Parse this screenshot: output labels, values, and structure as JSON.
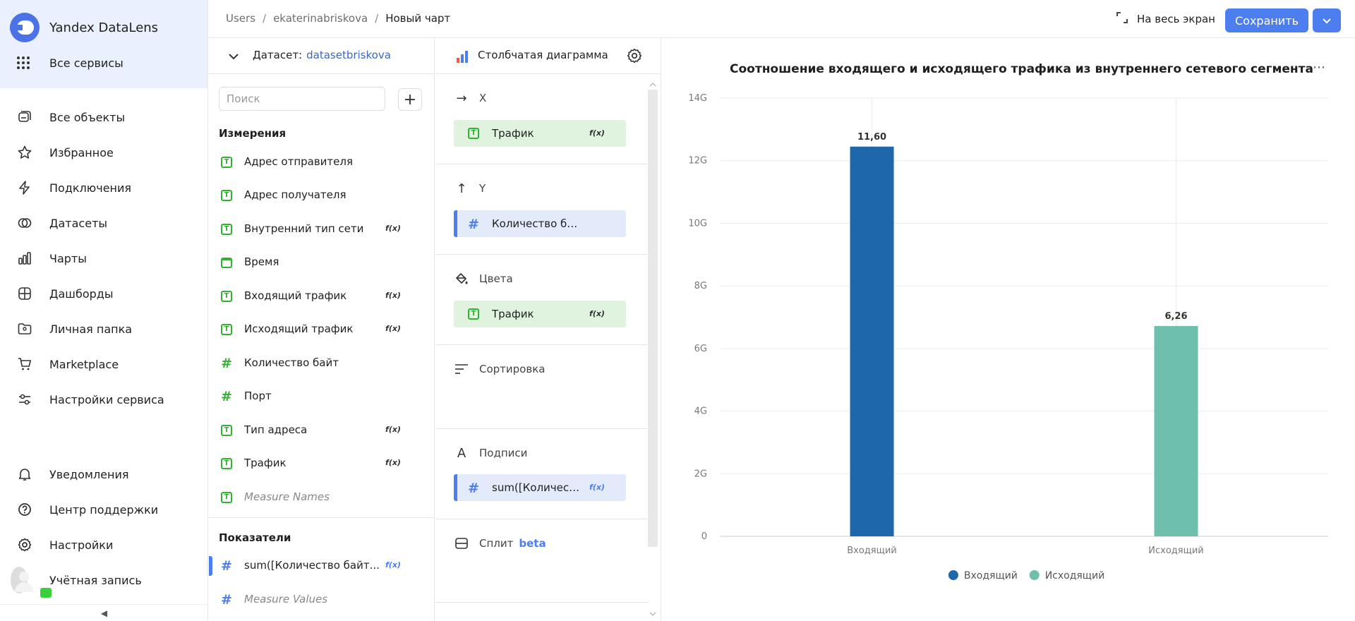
{
  "app": {
    "name": "Yandex DataLens",
    "all_services": "Все сервисы"
  },
  "nav": {
    "items": [
      {
        "label": "Все объекты",
        "icon": "objects-icon"
      },
      {
        "label": "Избранное",
        "icon": "star-icon"
      },
      {
        "label": "Подключения",
        "icon": "connection-icon"
      },
      {
        "label": "Датасеты",
        "icon": "datasets-icon"
      },
      {
        "label": "Чарты",
        "icon": "charts-icon"
      },
      {
        "label": "Дашборды",
        "icon": "dashboards-icon"
      },
      {
        "label": "Личная папка",
        "icon": "personal-folder-icon"
      },
      {
        "label": "Marketplace",
        "icon": "cart-icon"
      },
      {
        "label": "Настройки сервиса",
        "icon": "sliders-icon"
      }
    ],
    "bottom": [
      {
        "label": "Уведомления",
        "icon": "bell-icon"
      },
      {
        "label": "Центр поддержки",
        "icon": "help-icon"
      },
      {
        "label": "Настройки",
        "icon": "gear-icon"
      },
      {
        "label": "Учётная запись",
        "icon": "avatar"
      }
    ],
    "collapse": "◀"
  },
  "breadcrumbs": [
    "Users",
    "ekaterinabriskova",
    "Новый чарт"
  ],
  "toolbar": {
    "fullscreen": "На весь экран",
    "save": "Сохранить"
  },
  "dataset": {
    "label": "Датасет:",
    "name": "datasetbriskova",
    "search_placeholder": "Поиск",
    "dimensions_title": "Измерения",
    "dimensions": [
      {
        "label": "Адрес отправителя",
        "type": "text",
        "fx": ""
      },
      {
        "label": "Адрес получателя",
        "type": "text",
        "fx": ""
      },
      {
        "label": "Внутренний тип сети",
        "type": "text",
        "fx": "f(x)"
      },
      {
        "label": "Время",
        "type": "date",
        "fx": ""
      },
      {
        "label": "Входящий трафик",
        "type": "text",
        "fx": "f(x)"
      },
      {
        "label": "Исходящий трафик",
        "type": "text",
        "fx": "f(x)"
      },
      {
        "label": "Количество байт",
        "type": "number",
        "fx": ""
      },
      {
        "label": "Порт",
        "type": "number",
        "fx": ""
      },
      {
        "label": "Тип адреса",
        "type": "text",
        "fx": "f(x)"
      },
      {
        "label": "Трафик",
        "type": "text",
        "fx": "f(x)"
      },
      {
        "label": "Measure Names",
        "type": "text",
        "fx": ""
      }
    ],
    "measures_title": "Показатели",
    "measures": [
      {
        "label": "sum([Количество байт...",
        "fx": "f(x)"
      },
      {
        "label": "Measure Values",
        "fx": ""
      }
    ]
  },
  "visualization": {
    "type_label": "Столбчатая диаграмма",
    "sections": {
      "x": {
        "title": "X",
        "chip": "Трафик",
        "fx": "f(x)"
      },
      "y": {
        "title": "Y",
        "chip": "Количество байт"
      },
      "colors": {
        "title": "Цвета",
        "chip": "Трафик",
        "fx": "f(x)"
      },
      "sort": {
        "title": "Сортировка"
      },
      "labels": {
        "title": "Подписи",
        "chip": "sum([Количество байт])",
        "fx": "f(x)"
      },
      "split": {
        "title": "Сплит",
        "badge": "beta"
      }
    }
  },
  "chart_data": {
    "type": "bar",
    "title": "Соотношение входящего и исходящего трафика из внутреннего сетевого сегмента",
    "categories": [
      "Входящий",
      "Исходящий"
    ],
    "values": [
      12.45,
      6.72
    ],
    "data_labels": [
      "11,60",
      "6,26"
    ],
    "colors": [
      "#1f67ab",
      "#6ec0ad"
    ],
    "ylim": [
      0,
      14
    ],
    "yticks": [
      0,
      2,
      4,
      6,
      8,
      10,
      12,
      14
    ],
    "ytick_labels": [
      "0",
      "2G",
      "4G",
      "6G",
      "8G",
      "10G",
      "12G",
      "14G"
    ],
    "legend": [
      "Входящий",
      "Исходящий"
    ],
    "legend_position": "bottom",
    "grid": true
  }
}
